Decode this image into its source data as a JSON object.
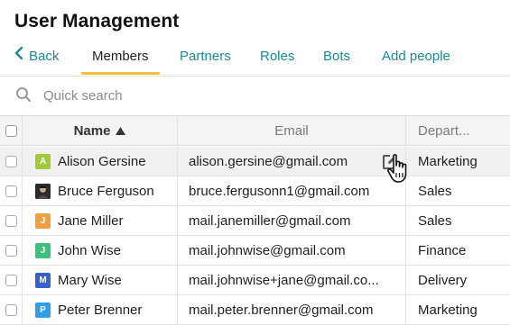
{
  "page": {
    "title": "User Management"
  },
  "tabs": [
    {
      "label": "Back"
    },
    {
      "label": "Members"
    },
    {
      "label": "Partners"
    },
    {
      "label": "Roles"
    },
    {
      "label": "Bots"
    },
    {
      "label": "Add people"
    }
  ],
  "search": {
    "placeholder": "Quick search",
    "value": ""
  },
  "table": {
    "columns": {
      "name": "Name",
      "email": "Email",
      "department": "Depart..."
    },
    "sort": {
      "column": "name",
      "direction": "ascending"
    },
    "rows": [
      {
        "initial": "A",
        "avatar_color": "#a3c93a",
        "name": "Alison Gersine",
        "email": "alison.gersine@gmail.com",
        "department": "Marketing"
      },
      {
        "initial": "",
        "avatar_color": "#2b2b2b",
        "name": "Bruce Ferguson",
        "email": "bruce.fergusonn1@gmail.com",
        "department": "Sales"
      },
      {
        "initial": "J",
        "avatar_color": "#f0a040",
        "name": "Jane Miller",
        "email": "mail.janemiller@gmail.com",
        "department": "Sales"
      },
      {
        "initial": "J",
        "avatar_color": "#3cc07a",
        "name": "John Wise",
        "email": "mail.johnwise@gmail.com",
        "department": "Finance"
      },
      {
        "initial": "M",
        "avatar_color": "#3a5fc8",
        "name": "Mary Wise",
        "email": "mail.johnwise+jane@gmail.co...",
        "department": "Delivery"
      },
      {
        "initial": "P",
        "avatar_color": "#2e9ee8",
        "name": "Peter Brenner",
        "email": "mail.peter.brenner@gmail.com",
        "department": "Marketing"
      }
    ]
  },
  "colors": {
    "accent_link": "#1a8a96",
    "active_tab_underline": "#f0c040"
  }
}
